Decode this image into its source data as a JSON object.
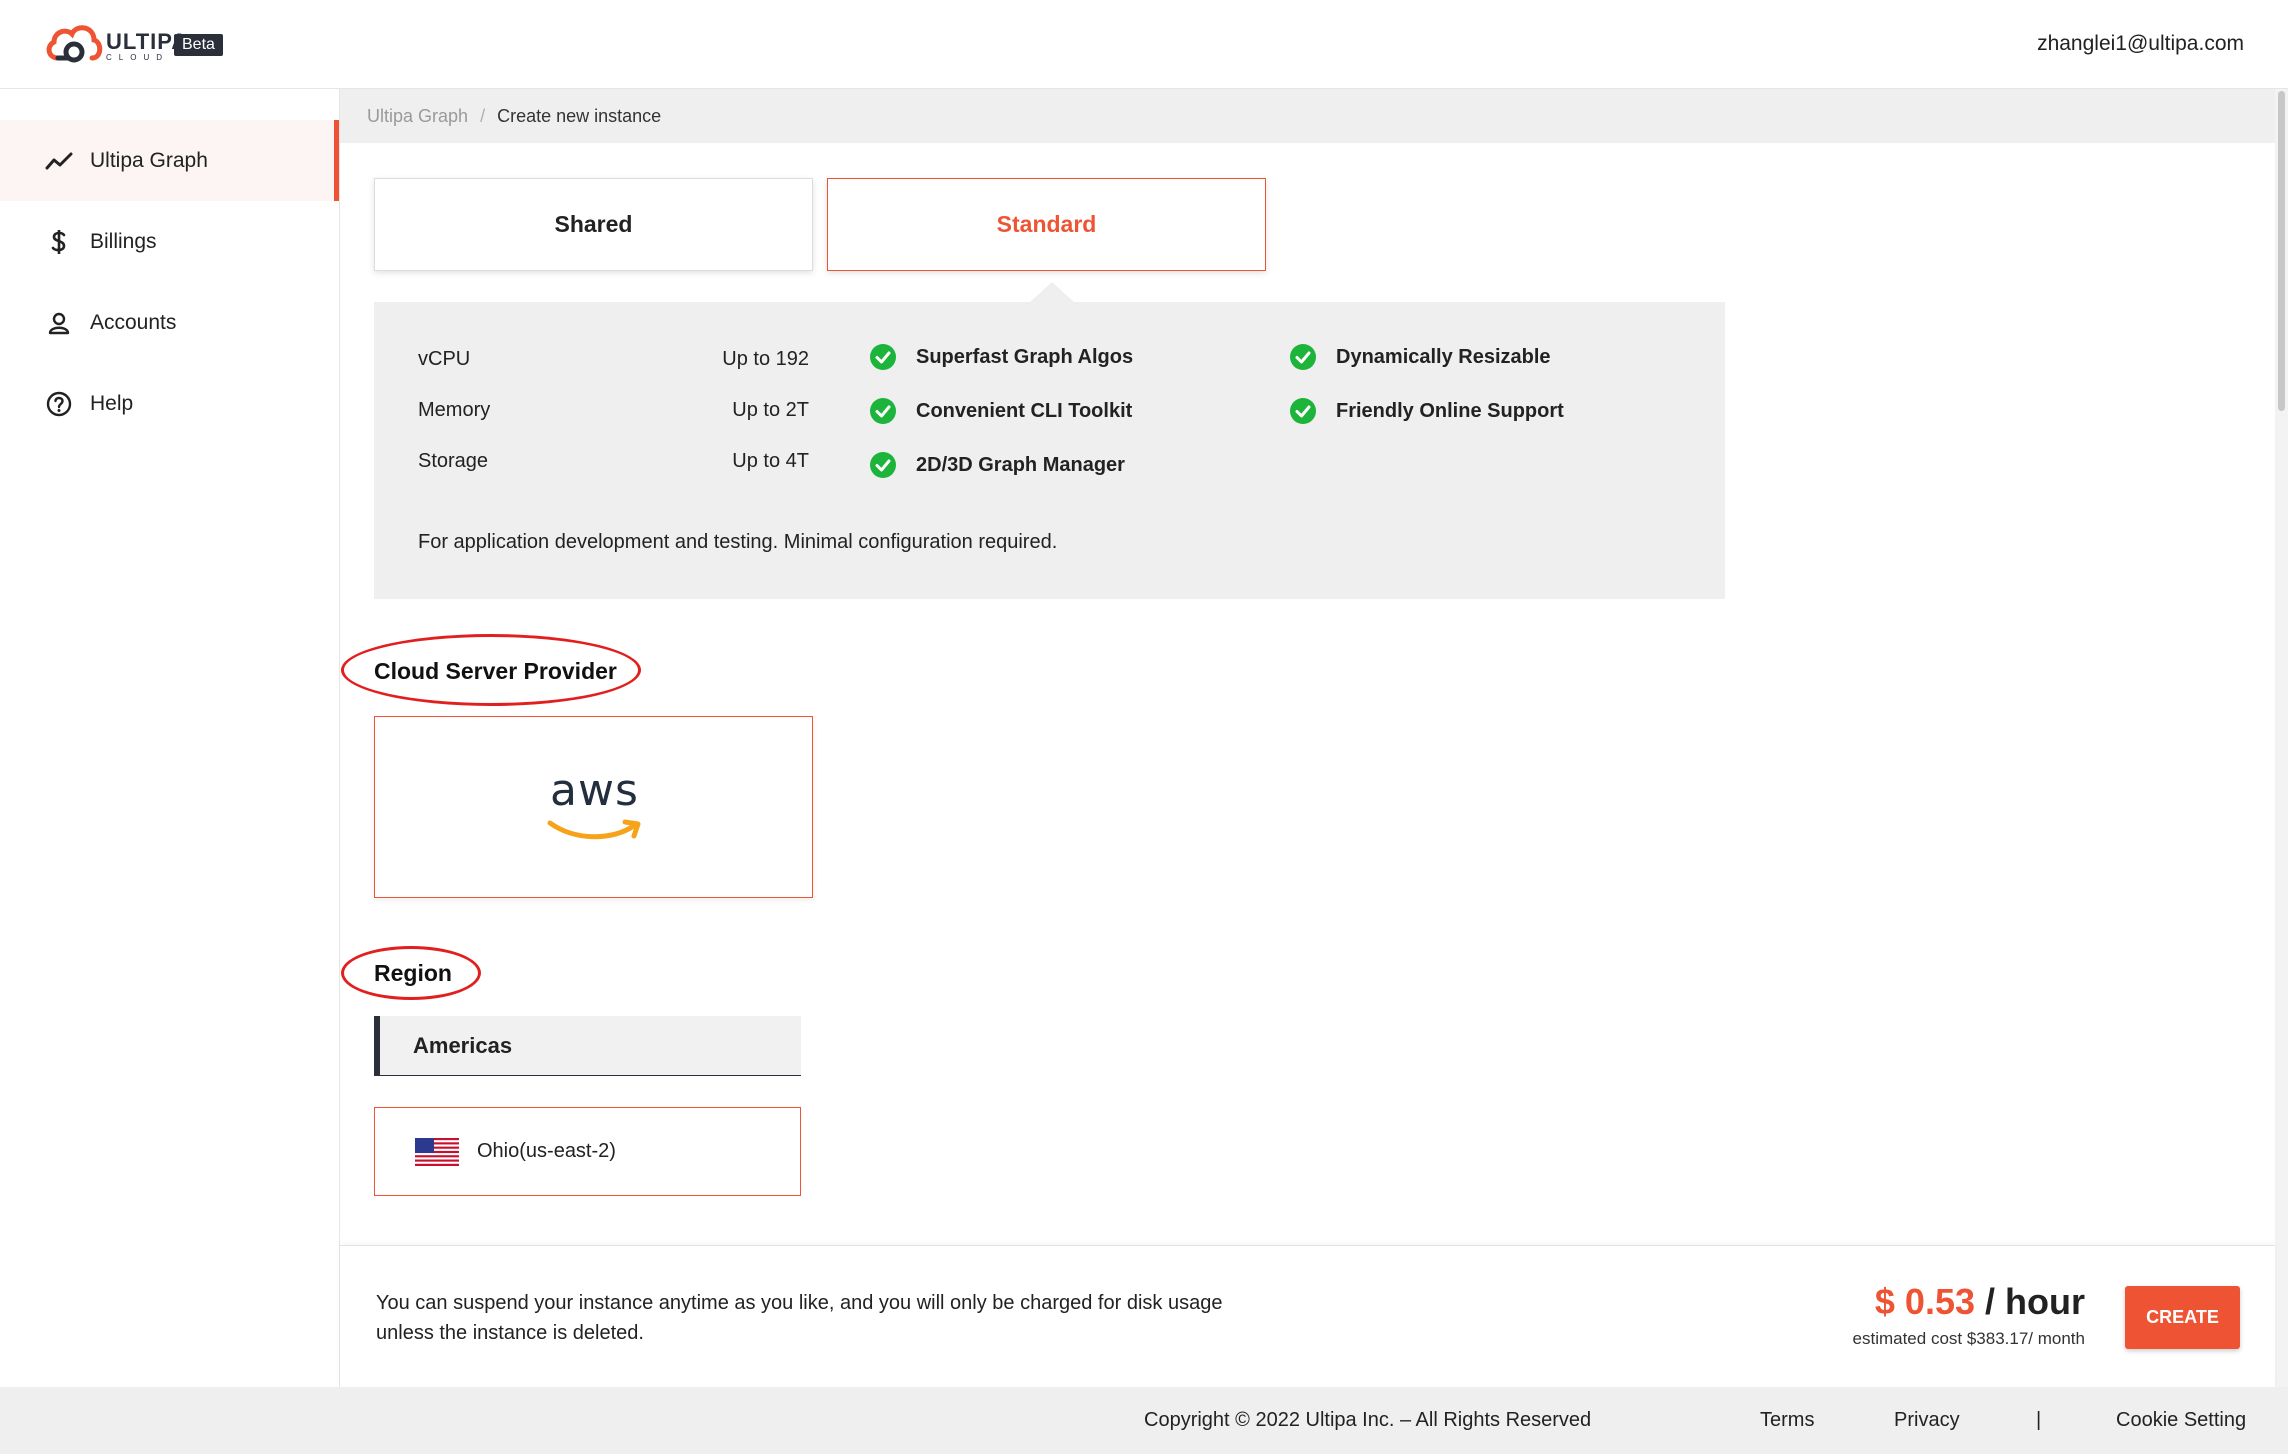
{
  "header": {
    "logo_word": "ULTIPA",
    "logo_sub": "CLOUD",
    "beta_label": "Beta",
    "user_email": "zhanglei1@ultipa.com"
  },
  "sidebar": {
    "items": [
      {
        "label": "Ultipa Graph",
        "icon": "trend-line-icon",
        "active": true
      },
      {
        "label": "Billings",
        "icon": "dollar-icon",
        "active": false
      },
      {
        "label": "Accounts",
        "icon": "user-icon",
        "active": false
      },
      {
        "label": "Help",
        "icon": "help-circle-icon",
        "active": false
      }
    ]
  },
  "breadcrumb": {
    "parent": "Ultipa Graph",
    "separator": "/",
    "current": "Create new instance"
  },
  "plans": {
    "shared_label": "Shared",
    "standard_label": "Standard",
    "selected": "Standard"
  },
  "specs": [
    {
      "label": "vCPU",
      "value": "Up to 192"
    },
    {
      "label": "Memory",
      "value": "Up to 2T"
    },
    {
      "label": "Storage",
      "value": "Up to 4T"
    }
  ],
  "features": [
    "Superfast Graph Algos",
    "Convenient CLI Toolkit",
    "2D/3D Graph Manager",
    "Dynamically Resizable",
    "Friendly Online Support"
  ],
  "plan_description": "For application development and testing. Minimal configuration required.",
  "provider": {
    "section_title": "Cloud Server Provider",
    "name": "aws"
  },
  "region": {
    "section_title": "Region",
    "tab_label": "Americas",
    "option_label": "Ohio(us-east-2)"
  },
  "action": {
    "note": "You can suspend your instance anytime as you like, and you will only be charged for disk usage unless the instance is deleted.",
    "price_amount": "$ 0.53",
    "price_unit": " / hour",
    "estimated": "estimated cost $383.17/ month",
    "create_label": "CREATE"
  },
  "footer": {
    "copyright": "Copyright © 2022 Ultipa Inc. – All Rights Reserved",
    "terms": "Terms",
    "privacy": "Privacy",
    "divider": "|",
    "cookie": "Cookie Setting"
  },
  "colors": {
    "accent": "#ee5434",
    "dark": "#2a2f3a",
    "check": "#1db43b",
    "annotation": "#e21f1f"
  }
}
